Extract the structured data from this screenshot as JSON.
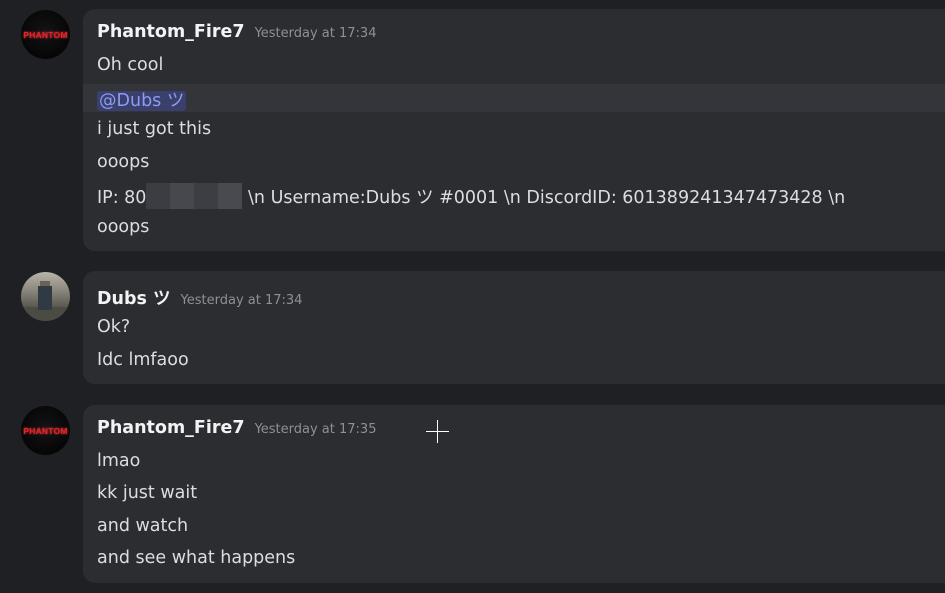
{
  "messages": [
    {
      "username": "Phantom_Fire7",
      "timestamp": "Yesterday at 17:34",
      "avatar_text": "PHANTOM",
      "lines": [
        "Oh cool",
        "@Dubs ツ",
        "i just got this",
        "ooops",
        {
          "prefix": "IP: 80",
          "suffix": " \\n Username:Dubs ツ #0001 \\n DiscordID: 601389241347473428 \\n"
        },
        "ooops"
      ]
    },
    {
      "username": "Dubs ツ",
      "timestamp": "Yesterday at 17:34",
      "lines": [
        "Ok?",
        "Idc lmfaoo"
      ]
    },
    {
      "username": "Phantom_Fire7",
      "timestamp": "Yesterday at 17:35",
      "avatar_text": "PHANTOM",
      "lines": [
        "lmao",
        "kk just wait",
        "and watch",
        "and see what happens"
      ]
    }
  ],
  "colors": {
    "background": "#1f2023",
    "bubble": "#2b2d31",
    "mention_text": "#8b9cf2",
    "mention_bg": "#3b3f6b",
    "avatar_logo": "#e0222a"
  }
}
